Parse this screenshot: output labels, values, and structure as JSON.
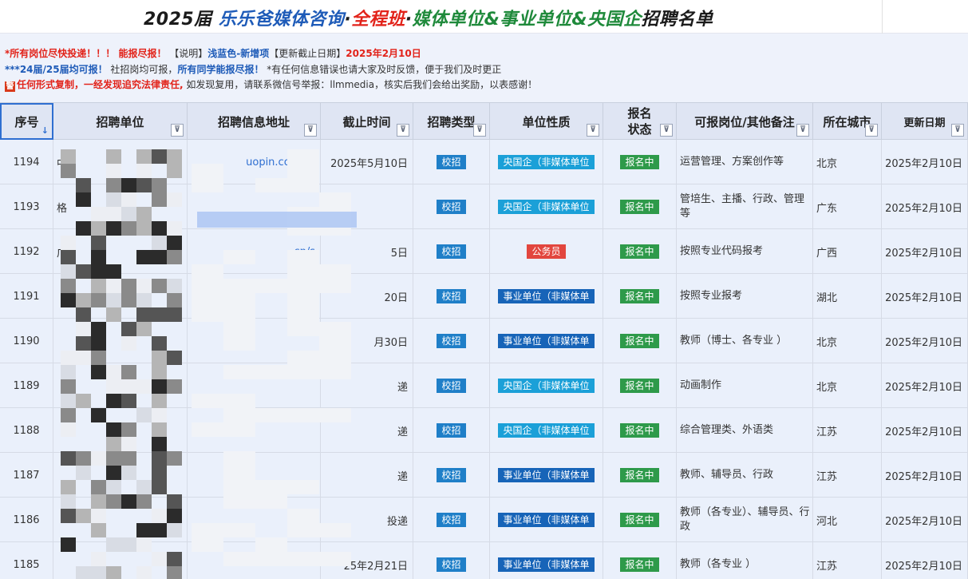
{
  "title": {
    "part1": "2025届 ",
    "part2": "乐乐爸媒体咨询",
    "dot1": "·",
    "part3": "全程班",
    "dot2": "·",
    "part4": "媒体单位&事业单位&央国企",
    "part5": "招聘名单"
  },
  "notes": {
    "line1_a": "*所有岗位尽快投递！！！ 能报尽报！",
    "line1_b": " 【说明】",
    "line1_c": "浅蓝色-新增项",
    "line1_d": "【更新截止日期】",
    "line1_e": "2025年2月10日",
    "line2_a": "***24届/25届均可报！",
    "line2_b": " 社招岗均可报，",
    "line2_c": "所有同学能报尽报！",
    "line2_d": " *有任何信息错误也请大家及时反馈，便于我们及时更正",
    "line3_icon": "警",
    "line3_a": "任何形式复制，一经发现追究法律责任,",
    "line3_b": " 如发现复用，请联系微信号举报：llmmedia，核实后我们会给出奖励，以表感谢！"
  },
  "headers": {
    "seq": "序号",
    "unit": "招聘单位",
    "url": "招聘信息地址",
    "deadline": "截止时间",
    "type": "招聘类型",
    "nature": "单位性质",
    "status": "报名状态",
    "positions": "可报岗位/其他备注",
    "city": "所在城市",
    "updated": "更新日期",
    "sort_icon": "↓",
    "filter_icon": "⊽"
  },
  "colors": {
    "header_bg": "#dfe5f3",
    "row_bg": "#eaf0fb",
    "badge_campus": "#1f7fc8",
    "badge_soe": "#1ba0d8",
    "badge_public": "#1764b8",
    "badge_civil": "#e2463e",
    "badge_status": "#2e9a4a"
  },
  "rows": [
    {
      "seq": "1194",
      "unit": "中",
      "url": "uopin.com/cc",
      "deadline": "2025年5月10日",
      "type": "校招",
      "nature": "央国企（非媒体单位",
      "nature_kind": "soe",
      "status": "报名中",
      "positions": "运营管理、方案创作等",
      "city": "北京",
      "updated": "2025年2月10日"
    },
    {
      "seq": "1193",
      "unit": "格",
      "url": "",
      "deadline": "",
      "type": "校招",
      "nature": "央国企（非媒体单位",
      "nature_kind": "soe",
      "status": "报名中",
      "positions": "管培生、主播、行政、管理等",
      "city": "广东",
      "updated": "2025年2月10日"
    },
    {
      "seq": "1192",
      "unit": "广",
      "url": "cn/s",
      "deadline": "5日",
      "type": "校招",
      "nature": "公务员",
      "nature_kind": "civil",
      "status": "报名中",
      "positions": "按照专业代码报考",
      "city": "广西",
      "updated": "2025年2月10日"
    },
    {
      "seq": "1191",
      "unit": "",
      "url": "syd",
      "deadline": "20日",
      "type": "校招",
      "nature": "事业单位（非媒体单",
      "nature_kind": "public",
      "status": "报名中",
      "positions": "按照专业报考",
      "city": "湖北",
      "updated": "2025年2月10日"
    },
    {
      "seq": "1190",
      "unit": "",
      "url": "",
      "deadline": "月30日",
      "type": "校招",
      "nature": "事业单位（非媒体单",
      "nature_kind": "public",
      "status": "报名中",
      "positions": "教师（博士、各专业 ）",
      "city": "北京",
      "updated": "2025年2月10日"
    },
    {
      "seq": "1189",
      "unit": "",
      "url": "",
      "deadline": "递",
      "type": "校招",
      "nature": "央国企（非媒体单位",
      "nature_kind": "soe",
      "status": "报名中",
      "positions": "动画制作",
      "city": "北京",
      "updated": "2025年2月10日"
    },
    {
      "seq": "1188",
      "unit": "",
      "url": "",
      "deadline": "递",
      "type": "校招",
      "nature": "央国企（非媒体单位",
      "nature_kind": "soe",
      "status": "报名中",
      "positions": "综合管理类、外语类",
      "city": "江苏",
      "updated": "2025年2月10日"
    },
    {
      "seq": "1187",
      "unit": "",
      "url": "",
      "deadline": "递",
      "type": "校招",
      "nature": "事业单位（非媒体单",
      "nature_kind": "public",
      "status": "报名中",
      "positions": "教师、辅导员、行政",
      "city": "江苏",
      "updated": "2025年2月10日"
    },
    {
      "seq": "1186",
      "unit": "",
      "url": "",
      "deadline": "投递",
      "type": "校招",
      "nature": "事业单位（非媒体单",
      "nature_kind": "public",
      "status": "报名中",
      "positions": "教师（各专业）、辅导员、行政",
      "city": "河北",
      "updated": "2025年2月10日"
    },
    {
      "seq": "1185",
      "unit": "",
      "url": "",
      "deadline": "25年2月21日",
      "type": "校招",
      "nature": "事业单位（非媒体单",
      "nature_kind": "public",
      "status": "报名中",
      "positions": "教师（各专业 ）",
      "city": "江苏",
      "updated": "2025年2月10日"
    }
  ]
}
